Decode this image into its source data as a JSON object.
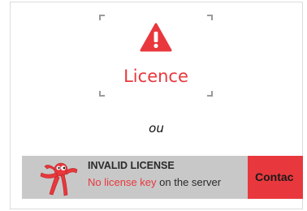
{
  "tile": {
    "icon": "warning-triangle-icon",
    "label": "Licence"
  },
  "separator": {
    "text": "ou"
  },
  "banner": {
    "mascot_icon": "red-mascot-icon",
    "title": "INVALID LICENSE",
    "message_highlight": "No license key",
    "message_rest": " on the server",
    "contact_label": "Contac"
  },
  "colors": {
    "accent": "#e8383d",
    "banner_bg": "#c8c8c8"
  }
}
